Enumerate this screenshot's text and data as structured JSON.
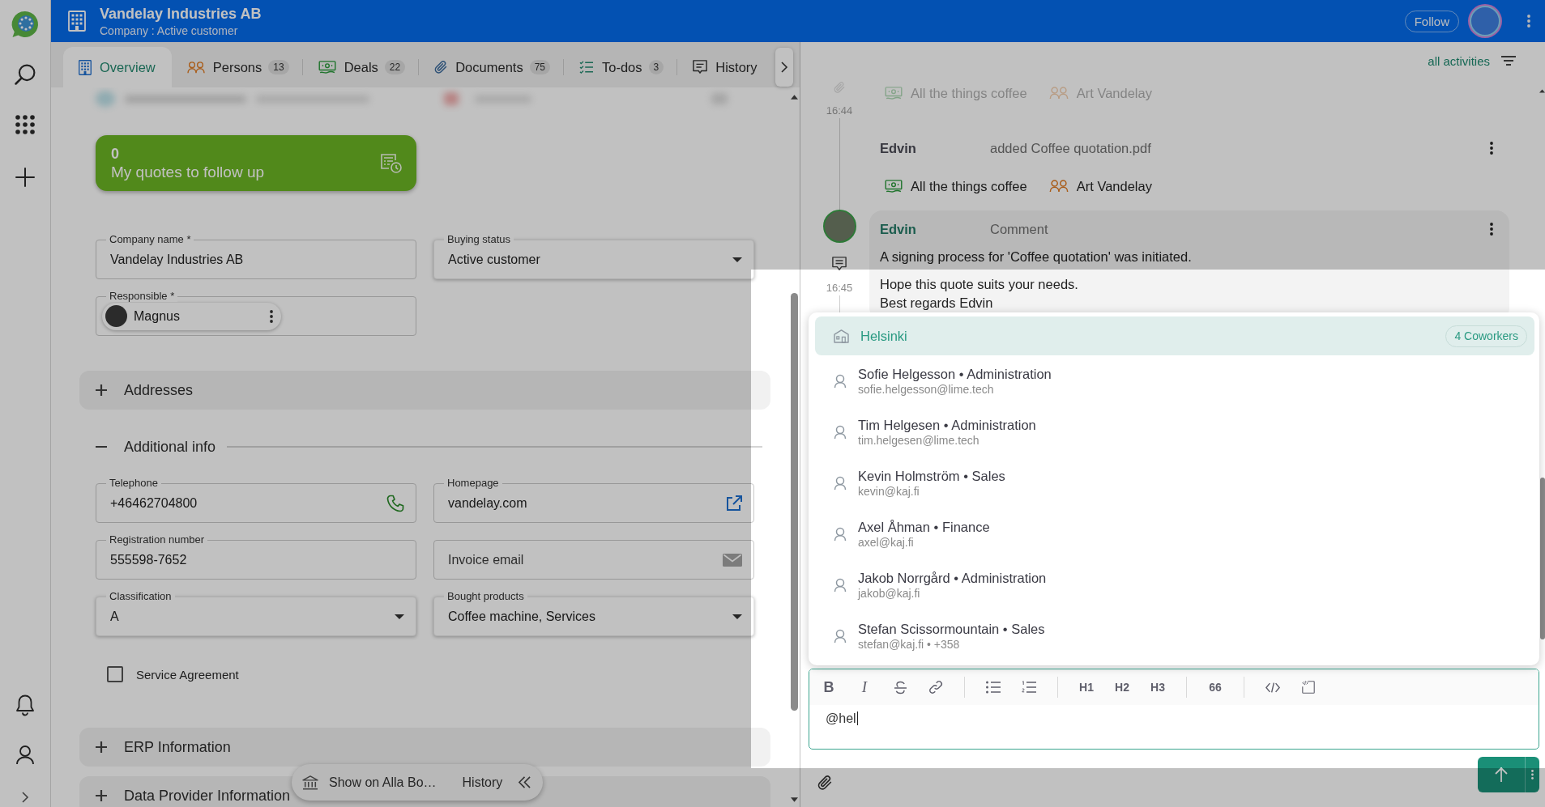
{
  "header": {
    "title": "Vandelay Industries AB",
    "subtitle": "Company : Active customer",
    "follow_label": "Follow"
  },
  "tabs": [
    {
      "kind": "overview",
      "label": "Overview",
      "selected": true
    },
    {
      "kind": "persons",
      "label": "Persons",
      "count": "13",
      "selected": false
    },
    {
      "kind": "deals",
      "label": "Deals",
      "count": "22",
      "selected": false
    },
    {
      "kind": "documents",
      "label": "Documents",
      "count": "75",
      "selected": false
    },
    {
      "kind": "todos",
      "label": "To-dos",
      "count": "3",
      "selected": false
    },
    {
      "kind": "history",
      "label": "History",
      "selected": false
    }
  ],
  "quote_card": {
    "count": "0",
    "label": "My quotes to follow up"
  },
  "main_fields": [
    {
      "kind": "text",
      "label": "Company name *",
      "value": "Vandelay Industries AB"
    },
    {
      "kind": "select",
      "label": "Buying status",
      "value": "Active customer"
    },
    {
      "kind": "person",
      "label": "Responsible *",
      "value": "Magnus"
    }
  ],
  "sections": [
    {
      "title": "Addresses",
      "expanded": false
    },
    {
      "title": "Additional info",
      "expanded": true,
      "fields": [
        {
          "kind": "phone",
          "label": "Telephone",
          "value": "+46462704800"
        },
        {
          "kind": "url",
          "label": "Homepage",
          "value": "vandelay.com"
        },
        {
          "kind": "text",
          "label": "Registration number",
          "value": "555598-7652"
        },
        {
          "kind": "email",
          "placeholder": "Invoice email"
        },
        {
          "kind": "select",
          "label": "Classification",
          "value": "A"
        },
        {
          "kind": "select",
          "label": "Bought products",
          "value": "Coffee machine, Services"
        },
        {
          "kind": "checkbox",
          "label": "Service Agreement",
          "checked": false
        }
      ]
    },
    {
      "title": "ERP Information",
      "expanded": false
    },
    {
      "title": "Data Provider Information",
      "expanded": false
    }
  ],
  "floating_bar": {
    "lookup_label": "Show on Alla Bo…",
    "history_label": "History"
  },
  "activity_filter": {
    "label": "all activities"
  },
  "feed": [
    {
      "kind": "links",
      "time": "16:44",
      "links": [
        {
          "kind": "deal",
          "label": "All the things coffee"
        },
        {
          "kind": "person",
          "label": "Art Vandelay"
        }
      ]
    },
    {
      "kind": "event",
      "author": "Edvin",
      "action": "added Coffee quotation.pdf",
      "links": [
        {
          "kind": "deal",
          "label": "All the things coffee"
        },
        {
          "kind": "person",
          "label": "Art Vandelay"
        }
      ]
    },
    {
      "kind": "comment",
      "author": "Edvin",
      "category": "Comment",
      "time": "16:45",
      "paragraphs": [
        "A signing process for 'Coffee quotation' was initiated.",
        "Hope this quote suits your needs.\nBest regards Edvin"
      ]
    }
  ],
  "mention_menu": {
    "options": [
      {
        "kind": "group",
        "label": "Helsinki",
        "badge": "4 Coworkers",
        "selected": true
      },
      {
        "kind": "person",
        "label": "Sofie Helgesson • Administration",
        "detail": "sofie.helgesson@lime.tech",
        "selected": false
      },
      {
        "kind": "person",
        "label": "Tim Helgesen • Administration",
        "detail": "tim.helgesen@lime.tech",
        "selected": false
      },
      {
        "kind": "person",
        "label": "Kevin Holmström • Sales",
        "detail": "kevin@kaj.fi",
        "selected": false
      },
      {
        "kind": "person",
        "label": "Axel Åhman • Finance",
        "detail": "axel@kaj.fi",
        "selected": false
      },
      {
        "kind": "person",
        "label": "Jakob Norrgård • Administration",
        "detail": "jakob@kaj.fi",
        "selected": false
      },
      {
        "kind": "person",
        "label": "Stefan Scissormountain • Sales",
        "detail": "stefan@kaj.fi • +358",
        "selected": false
      }
    ]
  },
  "editor": {
    "toolbar": [
      {
        "items": [
          {
            "kind": "bold",
            "label": "B"
          },
          {
            "kind": "italic",
            "label": "I"
          },
          {
            "kind": "strike"
          },
          {
            "kind": "link"
          }
        ]
      },
      {
        "items": [
          {
            "kind": "bullet_list"
          },
          {
            "kind": "ordered_list"
          }
        ]
      },
      {
        "items": [
          {
            "kind": "heading",
            "label": "H1"
          },
          {
            "kind": "heading",
            "label": "H2"
          },
          {
            "kind": "heading",
            "label": "H3"
          }
        ]
      },
      {
        "items": [
          {
            "kind": "quote",
            "label": "66"
          }
        ]
      },
      {
        "items": [
          {
            "kind": "code"
          },
          {
            "kind": "code_block"
          }
        ]
      }
    ],
    "value": "@hel"
  }
}
